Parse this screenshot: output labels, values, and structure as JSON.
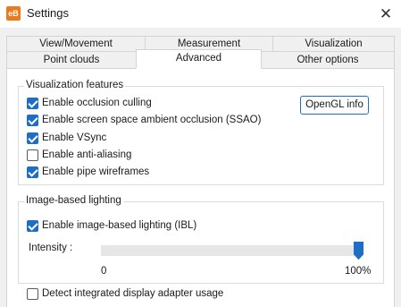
{
  "window": {
    "title": "Settings",
    "app_icon_text": "eB",
    "close_glyph": "✕"
  },
  "tabs": {
    "row1": [
      "View/Movement",
      "Measurement",
      "Visualization"
    ],
    "row2": [
      "Point clouds",
      "Advanced",
      "Other options"
    ],
    "active": "Advanced"
  },
  "visualization_features": {
    "title": "Visualization features",
    "items": [
      {
        "label": "Enable occlusion culling",
        "checked": true
      },
      {
        "label": "Enable screen space ambient occlusion (SSAO)",
        "checked": true
      },
      {
        "label": "Enable VSync",
        "checked": true
      },
      {
        "label": "Enable anti-aliasing",
        "checked": false
      },
      {
        "label": "Enable pipe wireframes",
        "checked": true
      }
    ],
    "opengl_button": "OpenGL info"
  },
  "ibl": {
    "title": "Image-based lighting",
    "enable_label": "Enable image-based lighting (IBL)",
    "enable_checked": true,
    "intensity_label": "Intensity :",
    "intensity_value": 1.0,
    "min_label": "0",
    "max_label": "100%"
  },
  "detect_adapter": {
    "label": "Detect integrated display adapter usage",
    "checked": false
  },
  "colors": {
    "accent": "#1e6ec8",
    "app_icon": "#ec7a1c",
    "background": "#f0f0f0"
  }
}
